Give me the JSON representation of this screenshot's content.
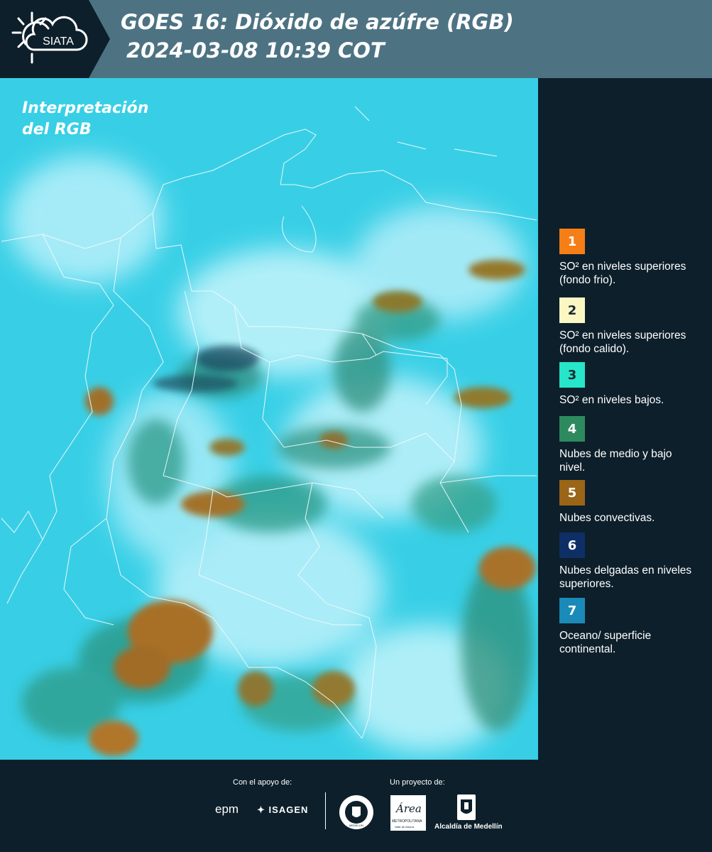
{
  "header": {
    "logo_text": "SIATA",
    "title_line1": "GOES 16: Dióxido de azúfre (RGB)",
    "title_line2": "2024-03-08 10:39 COT"
  },
  "legend": {
    "title_line1": "Interpretación",
    "title_line2": "del RGB",
    "items": [
      {
        "number": "1",
        "color": "#f57e16",
        "text_color": "#ffffff",
        "label": "SO² en niveles superiores (fondo frio)."
      },
      {
        "number": "2",
        "color": "#fcf6c3",
        "text_color": "#1b2a33",
        "label": "SO² en niveles superiores (fondo calido)."
      },
      {
        "number": "3",
        "color": "#27e5c8",
        "text_color": "#1b2a33",
        "label": "SO² en niveles bajos."
      },
      {
        "number": "4",
        "color": "#2d8a5f",
        "text_color": "#ffffff",
        "label": "Nubes de medio y bajo nivel."
      },
      {
        "number": "5",
        "color": "#9a6517",
        "text_color": "#ffffff",
        "label": "Nubes convectivas."
      },
      {
        "number": "6",
        "color": "#0e2f66",
        "text_color": "#ffffff",
        "label": "Nubes delgadas en niveles superiores."
      },
      {
        "number": "7",
        "color": "#1a8ab8",
        "text_color": "#ffffff",
        "label": "Oceano/ superficie continental."
      }
    ]
  },
  "footer": {
    "support_caption": "Con el apoyo de:",
    "project_caption": "Un proyecto de:",
    "sponsor_epm": "epm",
    "sponsor_isagen": "ISAGEN",
    "partner_area": "Área",
    "partner_area_sub": "METROPOLITANA",
    "partner_area_sub2": "Valle de Aburrá",
    "partner_medellin": "Alcaldía de Medellín",
    "seal_text": "MEDELLÍN"
  },
  "colors": {
    "header_bg": "#4d7383",
    "logo_bg": "#0d1f2b",
    "panel_bg": "#0d1f2b",
    "map_base": "#36d0e6"
  }
}
